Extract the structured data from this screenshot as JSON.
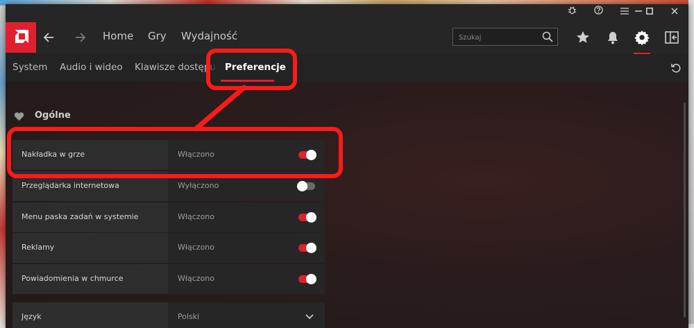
{
  "nav": {
    "back_icon": "back-arrow-icon",
    "forward_icon": "forward-arrow-icon",
    "links": [
      "Home",
      "Gry",
      "Wydajność"
    ]
  },
  "search": {
    "placeholder": "Szukaj",
    "icon": "search-icon"
  },
  "top_icons": [
    "star-icon",
    "bell-icon",
    "gear-icon",
    "sidebar-toggle-icon"
  ],
  "titlebar_icons": [
    "bug-icon",
    "help-icon",
    "menu-icon",
    "minimize-icon",
    "maximize-icon",
    "close-icon"
  ],
  "subtabs": [
    "System",
    "Audio i wideo",
    "Klawisze dostępu",
    "Preferencje"
  ],
  "active_subtab": "Preferencje",
  "section": {
    "title": "Ogólne",
    "icon": "heart-icon"
  },
  "settings": [
    {
      "label": "Nakładka w grze",
      "value": "Włączono",
      "on": true
    },
    {
      "label": "Przeglądarka internetowa",
      "value": "Wyłączono",
      "on": false
    },
    {
      "label": "Menu paska zadań w systemie",
      "value": "Włączono",
      "on": true
    },
    {
      "label": "Reklamy",
      "value": "Włączono",
      "on": true
    },
    {
      "label": "Powiadomienia w chmurce",
      "value": "Włączono",
      "on": true
    }
  ],
  "language": {
    "label": "Język",
    "value": "Polski"
  },
  "colors": {
    "accent": "#e0202e",
    "annotation": "#ff1a1a",
    "background": "#262626"
  }
}
